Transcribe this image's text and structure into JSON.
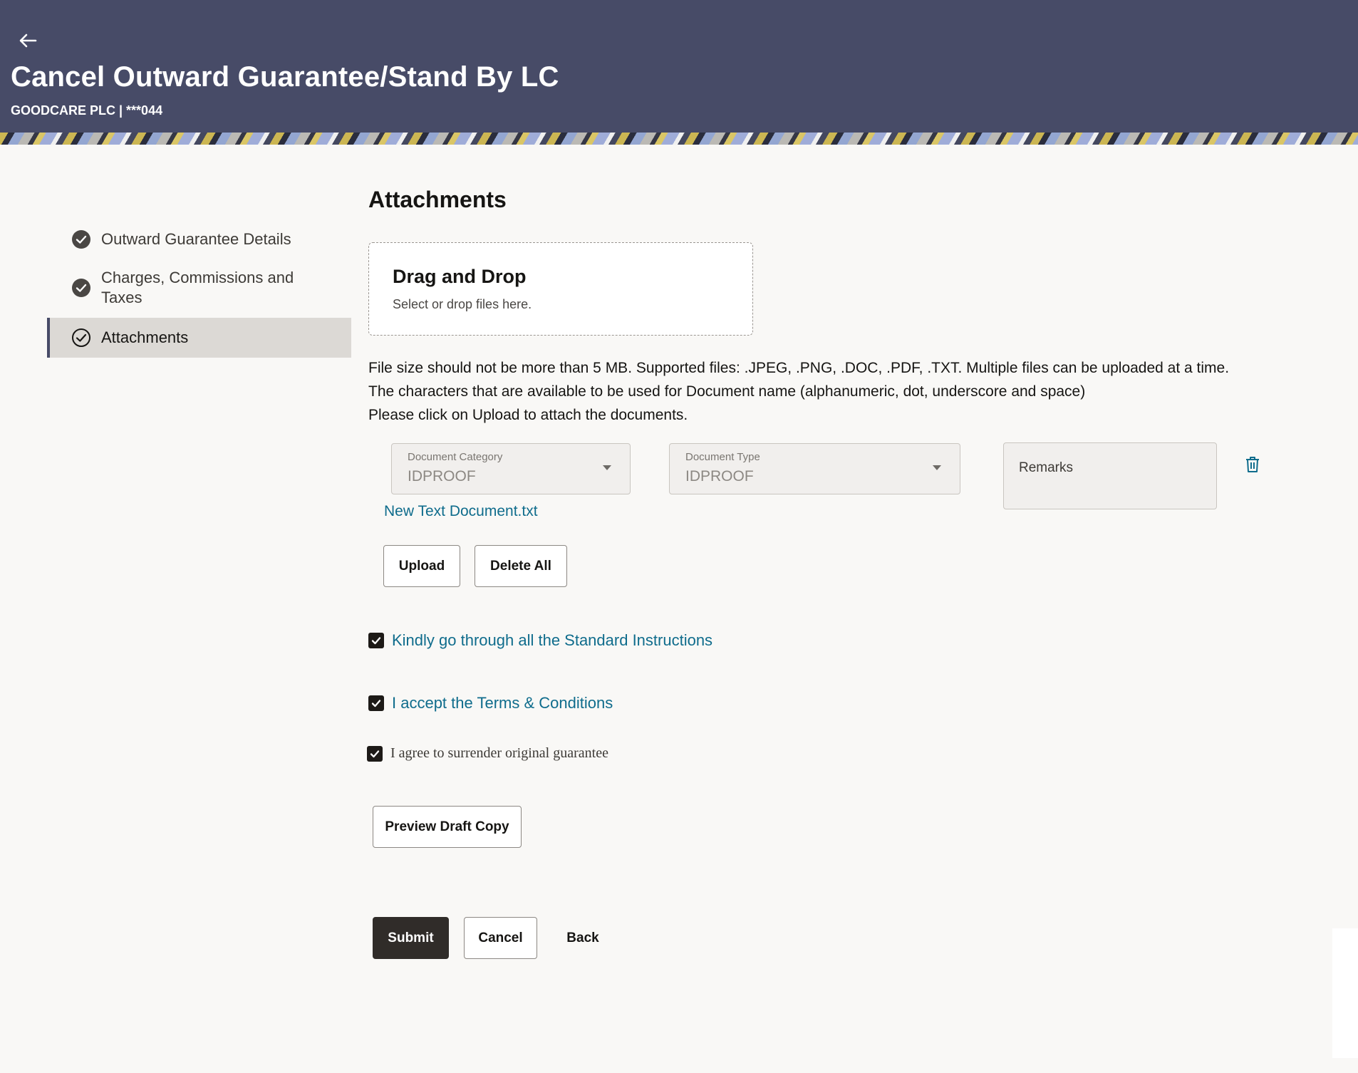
{
  "header": {
    "title": "Cancel Outward Guarantee/Stand By LC",
    "account": "GOODCARE PLC | ***044",
    "back_icon": "arrow-left-icon"
  },
  "stepper": {
    "steps": [
      {
        "label": "Outward Guarantee Details",
        "status": "completed"
      },
      {
        "label": "Charges, Commissions and Taxes",
        "status": "completed"
      },
      {
        "label": "Attachments",
        "status": "current"
      }
    ]
  },
  "attachments": {
    "title": "Attachments",
    "dropzone": {
      "title": "Drag and Drop",
      "subtitle": "Select or drop files here."
    },
    "info_lines": [
      "File size should not be more than 5 MB. Supported files: .JPEG, .PNG, .DOC, .PDF, .TXT. Multiple files can be uploaded at a time.",
      "The characters that are available to be used for Document name (alphanumeric, dot, underscore and space)",
      "Please click on Upload to attach the documents."
    ],
    "document_category": {
      "label": "Document Category",
      "value": "IDPROOF"
    },
    "document_type": {
      "label": "Document Type",
      "value": "IDPROOF"
    },
    "remarks": {
      "placeholder": "Remarks"
    },
    "file_name": "New Text Document.txt",
    "upload_label": "Upload",
    "delete_all_label": "Delete All"
  },
  "consents": {
    "standard_instructions": {
      "label": "Kindly go through all the Standard Instructions",
      "checked": true
    },
    "terms": {
      "label": "I accept the Terms & Conditions",
      "checked": true
    },
    "surrender": {
      "label": "I agree to surrender original guarantee",
      "checked": true
    }
  },
  "actions": {
    "preview_label": "Preview Draft Copy",
    "submit_label": "Submit",
    "cancel_label": "Cancel",
    "back_label": "Back"
  },
  "colors": {
    "header_bg": "#474b67",
    "link": "#0f6c8c",
    "primary_button": "#302c29",
    "page_bg": "#f9f8f6"
  }
}
